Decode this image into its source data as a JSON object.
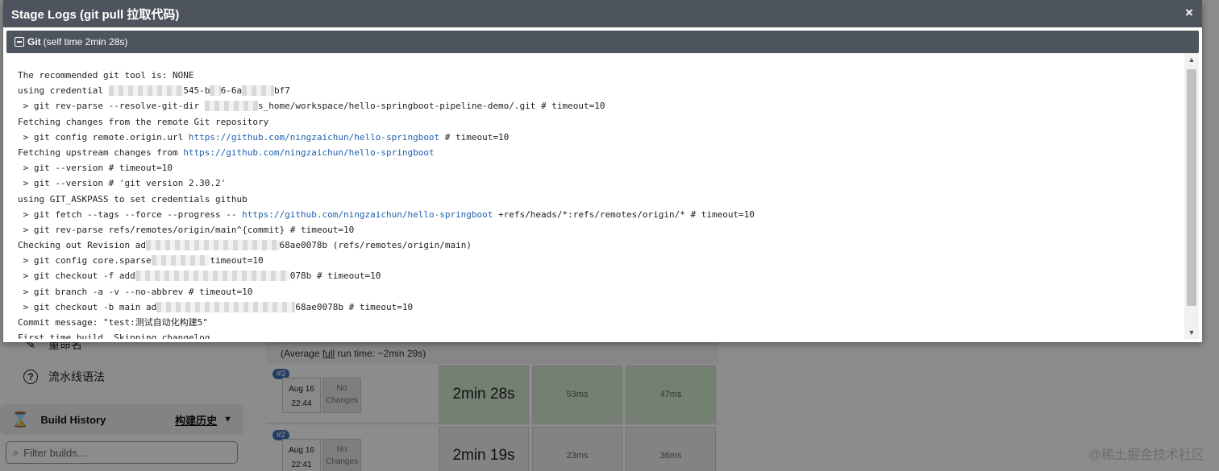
{
  "modal": {
    "title": "Stage Logs (git pull 拉取代码)",
    "close_symbol": "×",
    "section": {
      "name": "Git",
      "time": "(self time 2min 28s)"
    }
  },
  "log_lines": [
    [
      {
        "t": "The recommended git tool is: NONE"
      }
    ],
    [
      {
        "t": "using credential "
      },
      {
        "t": "xxxxxxxxxxxxxx",
        "cls": "blur"
      },
      {
        "t": "545-b"
      },
      {
        "t": "xx",
        "cls": "blur"
      },
      {
        "t": "6-6a"
      },
      {
        "t": "xxxxxx",
        "cls": "blur"
      },
      {
        "t": "bf7"
      }
    ],
    [
      {
        "t": " > git rev-parse --resolve-git-dir "
      },
      {
        "t": "xxxxxxxxxx",
        "cls": "blur"
      },
      {
        "t": "s_home/workspace/hello-springboot-pipeline-demo/.git # timeout=10"
      }
    ],
    [
      {
        "t": "Fetching changes from the remote Git repository"
      }
    ],
    [
      {
        "t": " > git config remote.origin.url "
      },
      {
        "t": "https://github.com/ningzaichun/hello-springboot",
        "cls": "link"
      },
      {
        "t": " # timeout=10"
      }
    ],
    [
      {
        "t": "Fetching upstream changes from "
      },
      {
        "t": "https://github.com/ningzaichun/hello-springboot",
        "cls": "link"
      }
    ],
    [
      {
        "t": " > git --version # timeout=10"
      }
    ],
    [
      {
        "t": " > git --version # 'git version 2.30.2'"
      }
    ],
    [
      {
        "t": "using GIT_ASKPASS to set credentials github"
      }
    ],
    [
      {
        "t": " > git fetch --tags --force --progress -- "
      },
      {
        "t": "https://github.com/ningzaichun/hello-springboot",
        "cls": "link"
      },
      {
        "t": " +refs/heads/*:refs/remotes/origin/* # timeout=10"
      }
    ],
    [
      {
        "t": " > git rev-parse refs/remotes/origin/main^{commit} # timeout=10"
      }
    ],
    [
      {
        "t": "Checking out Revision ad"
      },
      {
        "t": "xxxxxxxxxxxxxxxxxxxxxxxxx",
        "cls": "blur"
      },
      {
        "t": "68ae0078b (refs/remotes/origin/main)"
      }
    ],
    [
      {
        "t": " > git config core.sparse"
      },
      {
        "t": "xxxxxxxxxxx",
        "cls": "blur"
      },
      {
        "t": "timeout=10"
      }
    ],
    [
      {
        "t": " > git checkout -f add"
      },
      {
        "t": "xxxxxxxxxxxxxxxxxxxxxxxxxxxxx",
        "cls": "blur"
      },
      {
        "t": "078b # timeout=10"
      }
    ],
    [
      {
        "t": " > git branch -a -v --no-abbrev # timeout=10"
      }
    ],
    [
      {
        "t": " > git checkout -b main ad"
      },
      {
        "t": "xxxxxxxxxxxxxxxxxxxxxxxxxx",
        "cls": "blur"
      },
      {
        "t": "68ae0078b # timeout=10"
      }
    ],
    [
      {
        "t": "Commit message: \"test:测试自动化构建5\""
      }
    ],
    [
      {
        "t": "First time build. Skipping changelog."
      }
    ]
  ],
  "sidebar": {
    "rename_label": "重命名",
    "syntax_label": "流水线语法",
    "build_history_label": "Build History",
    "build_history_cn": "构建历史",
    "filter_placeholder": "Filter builds..."
  },
  "stage_view": {
    "avg_prefix": "(Average ",
    "avg_full": "full",
    "avg_suffix": " run time: ~2min 29s)",
    "runs": [
      {
        "id": "#3",
        "month_day": "Aug 16",
        "time": "22:44",
        "changes_1": "No",
        "changes_2": "Changes",
        "stages": [
          "2min 28s",
          "53ms",
          "47ms"
        ]
      },
      {
        "id": "#2",
        "month_day": "Aug 16",
        "time": "22:41",
        "changes_1": "No",
        "changes_2": "Changes",
        "stages": [
          "2min 19s",
          "23ms",
          "36ms"
        ]
      }
    ]
  },
  "watermark": "@稀土掘金技术社区",
  "colors": {
    "header": "#4d545d",
    "link": "#1d5fb0",
    "success": "#d2ead0"
  }
}
